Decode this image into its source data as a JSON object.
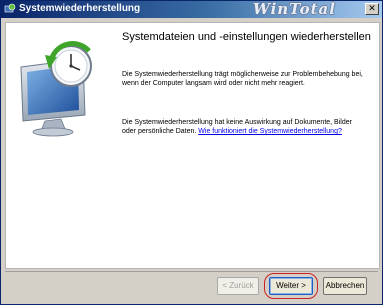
{
  "window": {
    "title": "Systemwiederherstellung",
    "watermark": "WinTotal",
    "close_glyph": "✕"
  },
  "main": {
    "heading": "Systemdateien und -einstellungen wiederherstellen",
    "paragraph1": "Die Systemwiederherstellung trägt möglicherweise zur Problembehebung bei, wenn der Computer langsam wird oder nicht mehr reagiert.",
    "paragraph2": "Die Systemwiederherstellung hat keine Auswirkung auf Dokumente, Bilder oder persönliche Daten.",
    "link": "Wie funktioniert die Systemwiederherstellung?"
  },
  "buttons": {
    "back": "< Zurück",
    "next": "Weiter >",
    "cancel": "Abbrechen"
  },
  "icons": {
    "title_icon": "system-restore-icon",
    "hero_icon": "monitor-restore-clock-icon"
  },
  "colors": {
    "titlebar_start": "#0a246a",
    "titlebar_end": "#a6caf0",
    "highlight": "#cc2222",
    "link": "#0000ee"
  }
}
